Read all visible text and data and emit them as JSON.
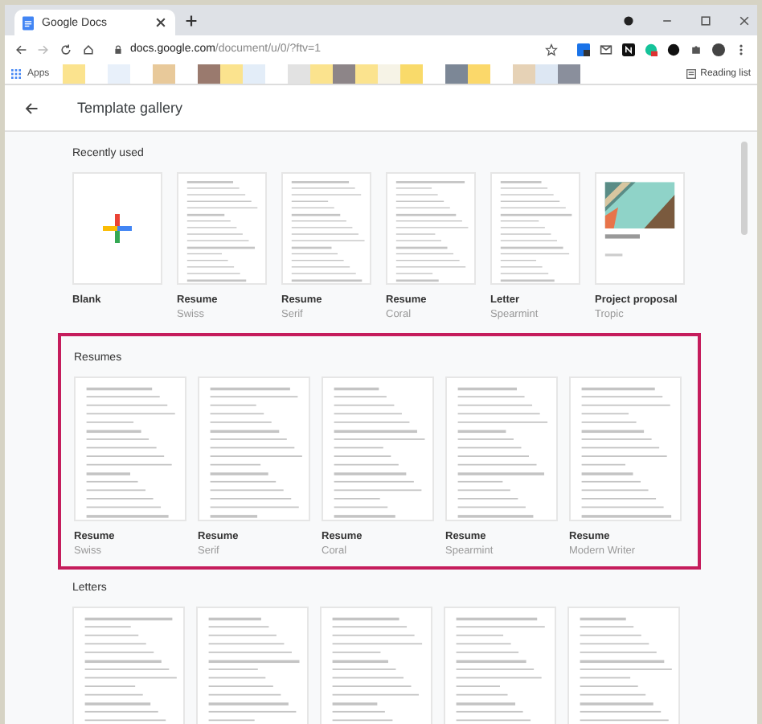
{
  "browser": {
    "tab_title": "Google Docs",
    "url_host": "docs.google.com",
    "url_path": "/document/u/0/?ftv=1",
    "apps_label": "Apps",
    "reading_list": "Reading list",
    "bookmark_groups": [
      [
        {
          "color": "#fbe38e"
        }
      ],
      [
        {
          "color": "#e8f0fa"
        }
      ],
      [
        {
          "color": "#e8c99a"
        }
      ],
      [
        {
          "color": "#9a7a6e"
        },
        {
          "color": "#fbe38e"
        },
        {
          "color": "#e3edf8"
        }
      ],
      [
        {
          "color": "#e2e2e2"
        },
        {
          "color": "#fbe38e"
        },
        {
          "color": "#8d8588"
        },
        {
          "color": "#fbe38e"
        },
        {
          "color": "#f6f3e6"
        },
        {
          "color": "#f9da6a"
        }
      ],
      [
        {
          "color": "#7c8796"
        },
        {
          "color": "#fbd86a"
        }
      ],
      [
        {
          "color": "#e6d2b6"
        },
        {
          "color": "#dde7f3"
        },
        {
          "color": "#8a8f9c"
        }
      ]
    ]
  },
  "header": {
    "title": "Template gallery"
  },
  "sections": [
    {
      "title": "Recently used",
      "highlighted": false,
      "kind": "compact",
      "templates": [
        {
          "title": "Blank",
          "kind": "blank"
        },
        {
          "title": "Resume",
          "subtitle": "Swiss",
          "kind": "document"
        },
        {
          "title": "Resume",
          "subtitle": "Serif",
          "kind": "document"
        },
        {
          "title": "Resume",
          "subtitle": "Coral",
          "kind": "document"
        },
        {
          "title": "Letter",
          "subtitle": "Spearmint",
          "kind": "document"
        },
        {
          "title": "Project proposal",
          "subtitle": "Tropic",
          "kind": "picture"
        }
      ]
    },
    {
      "title": "Resumes",
      "highlighted": true,
      "kind": "gallery",
      "templates": [
        {
          "title": "Resume",
          "subtitle": "Swiss",
          "kind": "document"
        },
        {
          "title": "Resume",
          "subtitle": "Serif",
          "kind": "document"
        },
        {
          "title": "Resume",
          "subtitle": "Coral",
          "kind": "document"
        },
        {
          "title": "Resume",
          "subtitle": "Spearmint",
          "kind": "document"
        },
        {
          "title": "Resume",
          "subtitle": "Modern Writer",
          "kind": "document"
        }
      ]
    },
    {
      "title": "Letters",
      "highlighted": false,
      "kind": "gallery",
      "templates": [
        {
          "kind": "document"
        },
        {
          "kind": "document"
        },
        {
          "kind": "document"
        },
        {
          "kind": "document"
        },
        {
          "kind": "document"
        }
      ]
    }
  ]
}
